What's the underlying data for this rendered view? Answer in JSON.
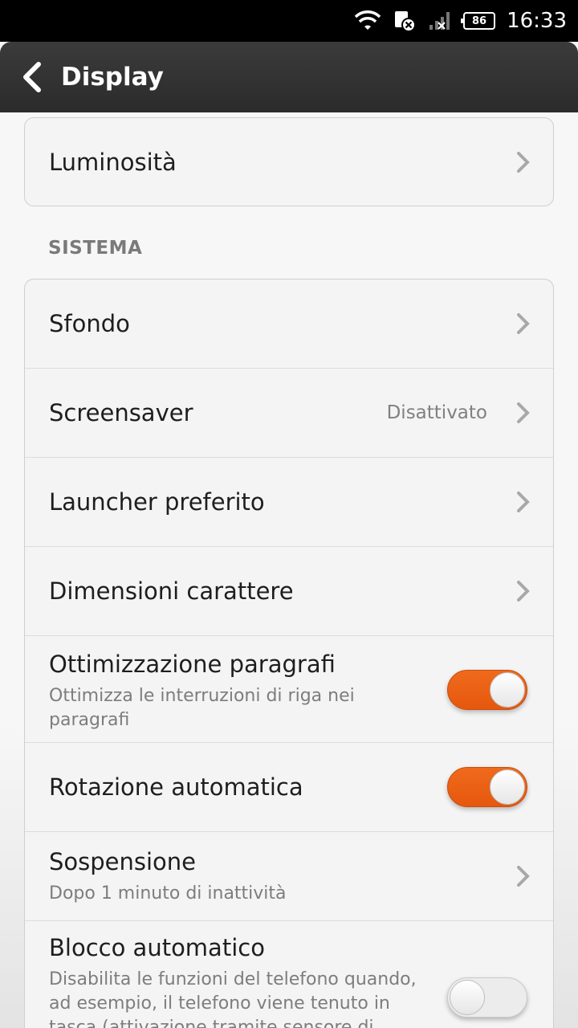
{
  "status_bar": {
    "battery": "86",
    "time": "16:33",
    "icons": [
      "wifi-icon",
      "sim-error-icon",
      "signal-off-icon",
      "battery-icon"
    ]
  },
  "action_bar": {
    "title": "Display",
    "back_icon": "chevron-left-icon"
  },
  "brightness": {
    "label": "Luminosità"
  },
  "section": {
    "header": "SISTEMA"
  },
  "items": {
    "wallpaper": {
      "title": "Sfondo"
    },
    "screensaver": {
      "title": "Screensaver",
      "value": "Disattivato"
    },
    "launcher": {
      "title": "Launcher preferito"
    },
    "font_size": {
      "title": "Dimensioni carattere"
    },
    "paragraph": {
      "title": "Ottimizzazione paragrafi",
      "subtitle": "Ottimizza le interruzioni di riga nei paragrafi",
      "enabled": true
    },
    "rotation": {
      "title": "Rotazione automatica",
      "enabled": true
    },
    "sleep": {
      "title": "Sospensione",
      "subtitle": "Dopo 1 minuto di inattività"
    },
    "autolock": {
      "title": "Blocco automatico",
      "subtitle": "Disabilita le funzioni del telefono quando, ad esempio, il telefono viene tenuto in tasca (attivazione tramite sensore di",
      "enabled": false
    }
  },
  "colors": {
    "accent": "#f06a1c",
    "action_bar": "#333333",
    "background": "#f7f7f7"
  }
}
